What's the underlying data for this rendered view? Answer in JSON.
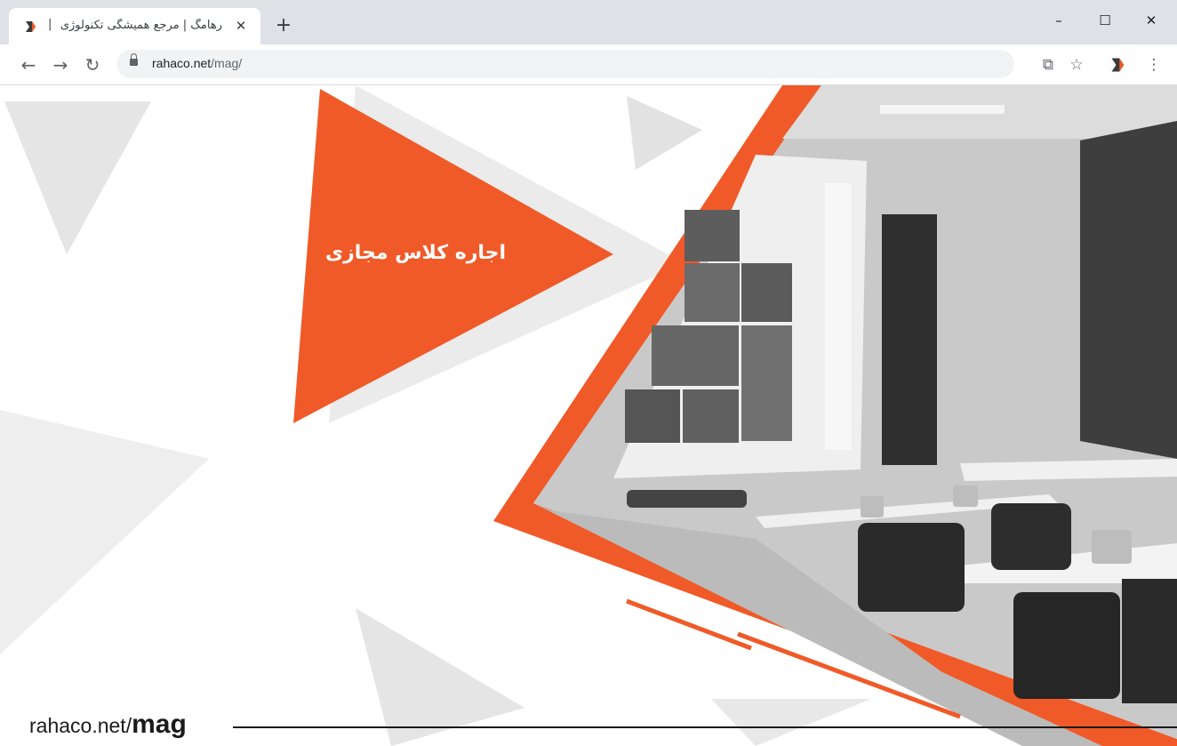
{
  "browser": {
    "tab": {
      "title": "رهامگ | مرجع همیشگی تکنولوژی",
      "separator": "|",
      "favicon": "rahaco-logo-icon",
      "close_label": "✕"
    },
    "new_tab_label": "+",
    "window_controls": {
      "minimize": "–",
      "maximize": "☐",
      "close": "✕"
    },
    "nav": {
      "back": "←",
      "forward": "→",
      "reload": "↻"
    },
    "address": {
      "domain": "rahaco.net",
      "path": "/mag/"
    },
    "toolbar_icons": [
      "translate-icon",
      "star-icon",
      "extension-icon",
      "menu-icon"
    ],
    "toolbar_glyphs": {
      "translate": "⧉",
      "star": "☆",
      "menu": "⋮"
    }
  },
  "page": {
    "headline": "اجاره کلاس مجازی",
    "site_url": {
      "domain": "rahaco.net/",
      "section": "mag"
    }
  },
  "colors": {
    "brand_orange": "#f05a28",
    "tab_strip": "#dee1e6",
    "omnibox": "#f1f3f4"
  }
}
